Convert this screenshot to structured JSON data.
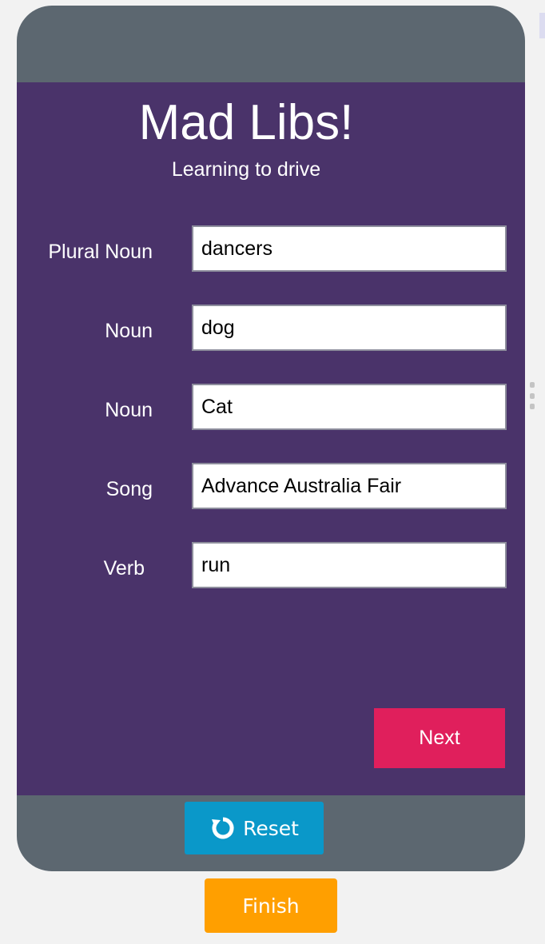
{
  "app": {
    "title": "Mad Libs!",
    "subtitle": "Learning to drive"
  },
  "form": {
    "fields": [
      {
        "label": "Plural Noun",
        "value": "dancers"
      },
      {
        "label": "Noun",
        "value": "dog"
      },
      {
        "label": "Noun",
        "value": "Cat"
      },
      {
        "label": "Song",
        "value": "Advance Australia Fair"
      },
      {
        "label": "Verb",
        "value": "run"
      }
    ],
    "next_label": "Next"
  },
  "controls": {
    "reset_label": "Reset",
    "reset_icon": "reset-icon",
    "finish_label": "Finish"
  },
  "colors": {
    "device_frame": "#5c6770",
    "screen_background": "#4a336a",
    "next_button": "#e01f5c",
    "reset_button": "#0a98c9",
    "finish_button": "#ff9f00"
  }
}
